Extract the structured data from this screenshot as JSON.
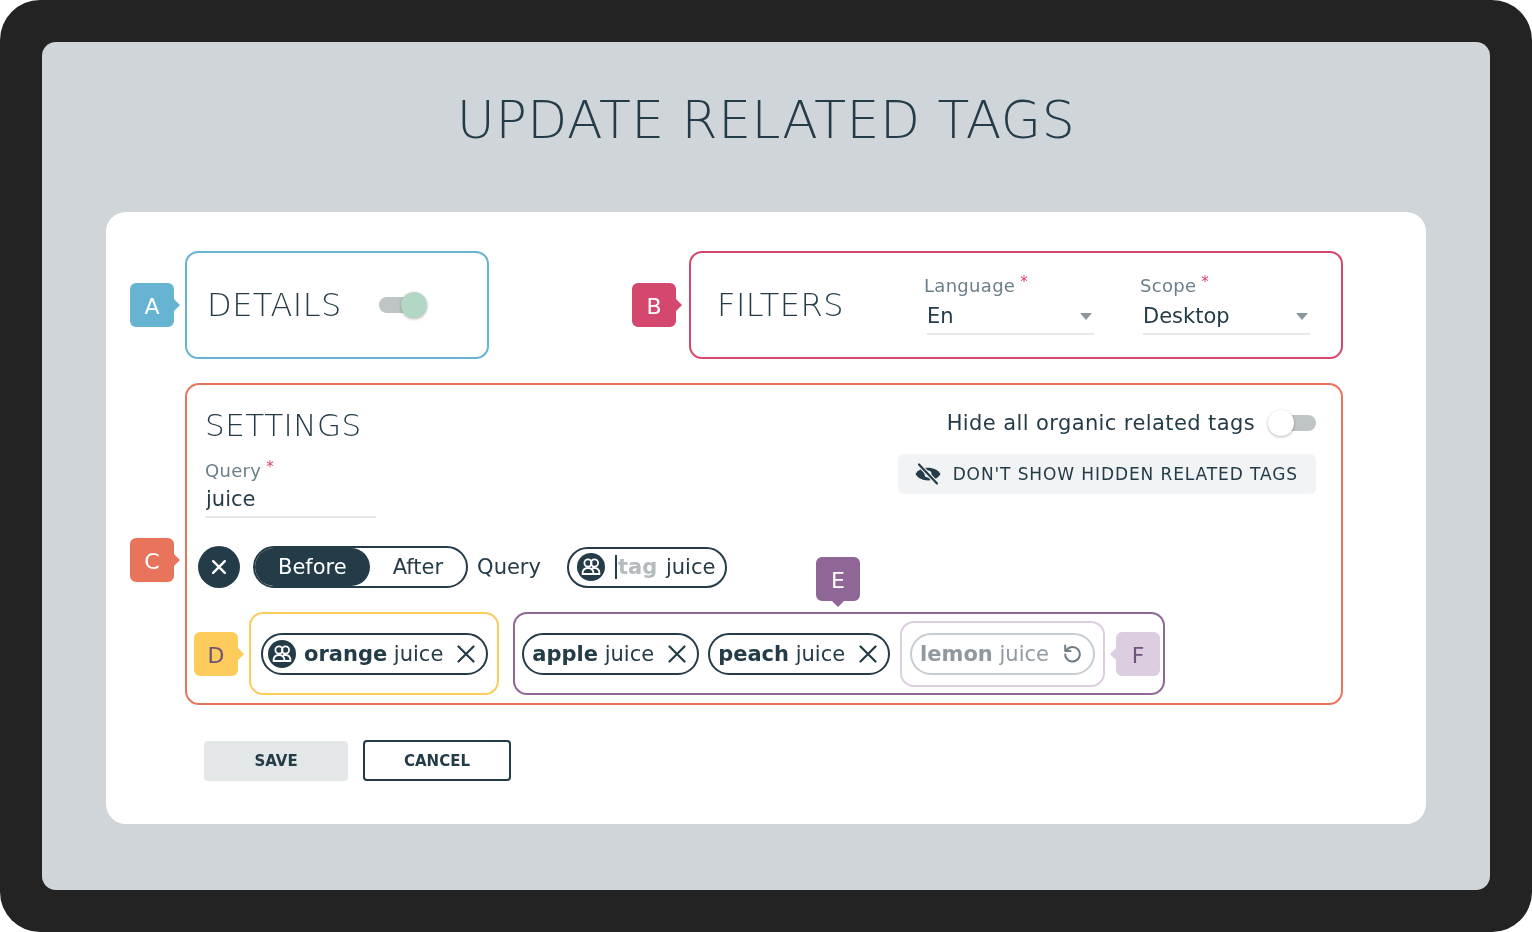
{
  "title": "UPDATE RELATED TAGS",
  "details": {
    "marker": {
      "label": "A",
      "color": "#66b4d2"
    },
    "heading": "DETAILS",
    "toggle": {
      "on": true
    }
  },
  "filters": {
    "marker": {
      "label": "B",
      "color": "#d3486c"
    },
    "heading": "FILTERS",
    "fields": [
      {
        "label": "Language",
        "required_mark": "*",
        "value": "En"
      },
      {
        "label": "Scope",
        "required_mark": "*",
        "value": "Desktop"
      }
    ]
  },
  "settings": {
    "marker": {
      "label": "C",
      "color": "#e8745b"
    },
    "heading": "SETTINGS",
    "query_field": {
      "label": "Query",
      "required_mark": "*",
      "value": "juice"
    },
    "hide_organic": {
      "label": "Hide all organic related tags",
      "on": false
    },
    "hidden_tags_button": {
      "label": "DON'T SHOW HIDDEN RELATED TAGS"
    },
    "position_options": [
      {
        "label": "Before",
        "selected": true
      },
      {
        "label": "After",
        "selected": false
      }
    ],
    "position_reference": "Query",
    "tag_input": {
      "placeholder": "tag",
      "focused": true,
      "suffix": "juice"
    },
    "curated_group": {
      "marker": {
        "label": "D",
        "color": "#fccb5c"
      },
      "tags": [
        {
          "text": "**orange** juice",
          "kind": "curated"
        }
      ]
    },
    "related_group": {
      "marker": {
        "label": "E",
        "color": "#8e6796"
      },
      "tags": [
        {
          "text": "**apple** juice",
          "kind": "related"
        },
        {
          "text": "**peach** juice",
          "kind": "related"
        }
      ],
      "hidden_group": {
        "marker": {
          "label": "F",
          "color": "#ddcde0"
        },
        "tags": [
          {
            "text": "**lemon** juice",
            "kind": "hidden"
          }
        ]
      }
    }
  },
  "buttons": [
    {
      "label": "SAVE",
      "kind": "filled"
    },
    {
      "label": "CANCEL",
      "kind": "outline"
    }
  ]
}
